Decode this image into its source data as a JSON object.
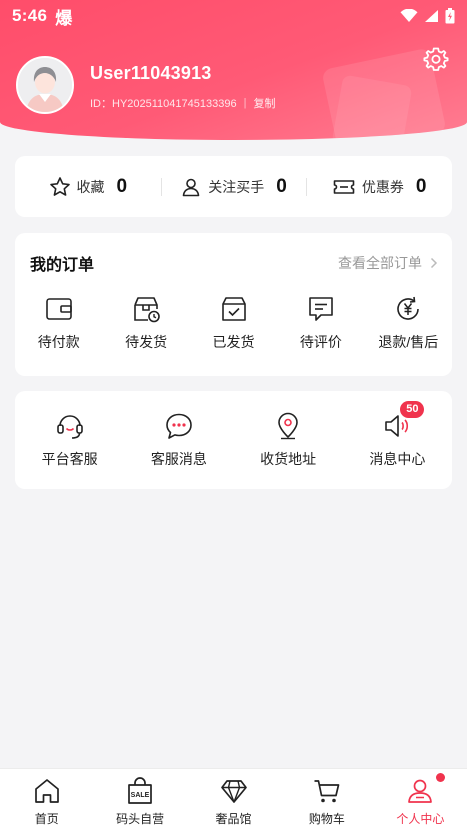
{
  "status_bar": {
    "time": "5:46",
    "glyph": "爆",
    "icons": [
      "wifi-icon",
      "signal-icon",
      "battery-icon"
    ]
  },
  "profile": {
    "username": "User11043913",
    "user_id": "ID：HY202511041745133396",
    "copy_label": "复制"
  },
  "stats": [
    {
      "icon": "star-icon",
      "label": "收藏",
      "count": "0"
    },
    {
      "icon": "person-icon",
      "label": "关注买手",
      "count": "0"
    },
    {
      "icon": "ticket-icon",
      "label": "优惠券",
      "count": "0"
    }
  ],
  "orders": {
    "title": "我的订单",
    "view_all": "查看全部订单",
    "items": [
      {
        "icon": "wallet-icon",
        "label": "待付款"
      },
      {
        "icon": "box-clock-icon",
        "label": "待发货"
      },
      {
        "icon": "box-check-icon",
        "label": "已发货"
      },
      {
        "icon": "comment-icon",
        "label": "待评价"
      },
      {
        "icon": "refund-icon",
        "label": "退款/售后"
      }
    ]
  },
  "services": {
    "items": [
      {
        "icon": "headset-icon",
        "label": "平台客服"
      },
      {
        "icon": "chat-bubble-icon",
        "label": "客服消息"
      },
      {
        "icon": "location-pin-icon",
        "label": "收货地址"
      },
      {
        "icon": "speaker-icon",
        "label": "消息中心",
        "badge": "50"
      }
    ]
  },
  "tabbar": {
    "items": [
      {
        "icon": "home-icon",
        "label": "首页"
      },
      {
        "icon": "sale-bag-icon",
        "label": "码头自营"
      },
      {
        "icon": "diamond-icon",
        "label": "奢品馆"
      },
      {
        "icon": "cart-icon",
        "label": "购物车"
      },
      {
        "icon": "user-center-icon",
        "label": "个人中心",
        "active": true
      }
    ]
  },
  "colors": {
    "accent": "#f0334d",
    "header_gradient_start": "#ff4d6a",
    "header_gradient_end": "#ff7d92",
    "background": "#f4f4f6"
  }
}
